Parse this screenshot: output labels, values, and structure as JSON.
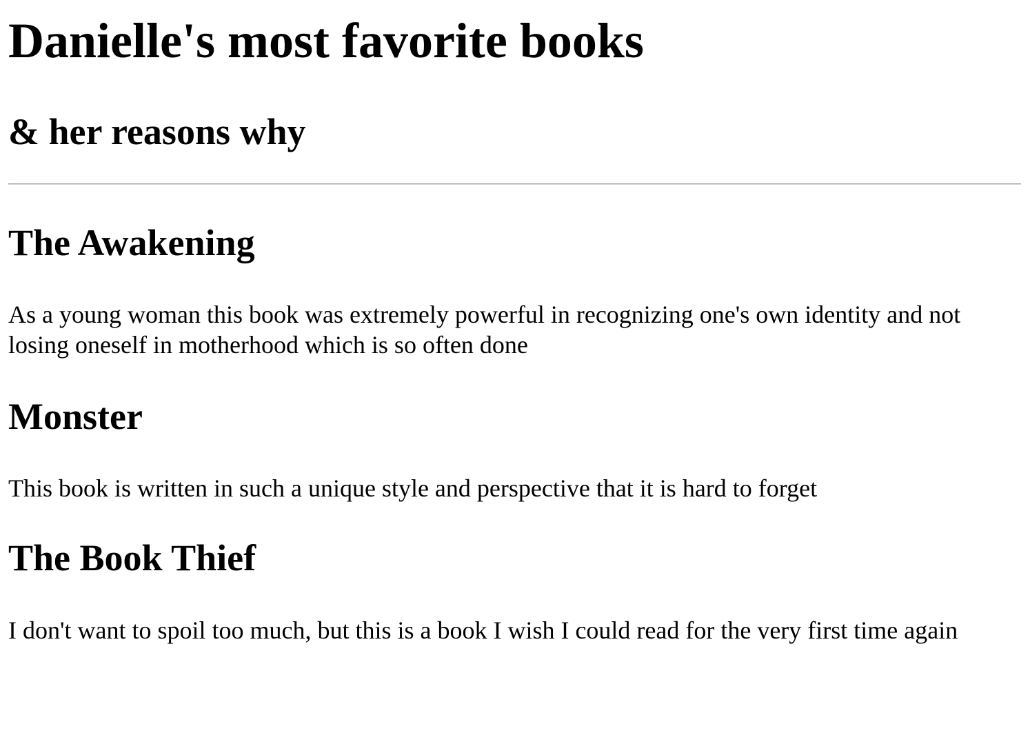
{
  "page": {
    "title": "Danielle's most favorite books",
    "subtitle": "& her reasons why"
  },
  "books": [
    {
      "title": "The Awakening",
      "reason": "As a young woman this book was extremely powerful in recognizing one's own identity and not losing oneself in motherhood which is so often done"
    },
    {
      "title": "Monster",
      "reason": "This book is written in such a unique style and perspective that it is hard to forget"
    },
    {
      "title": "The Book Thief",
      "reason": "I don't want to spoil too much, but this is a book I wish I could read for the very first time again"
    }
  ]
}
